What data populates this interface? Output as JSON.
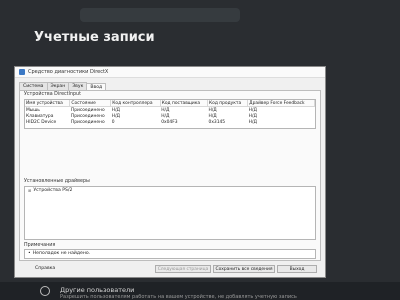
{
  "background": {
    "page_title": "Учетные записи",
    "section_title": "Другие пользователи",
    "section_desc": "Разрешить пользователям работать на вашем устройстве, не добавлять учетную запись"
  },
  "dialog": {
    "title": "Средство диагностики DirectX",
    "tabs": [
      "Система",
      "Экран",
      "Звук",
      "Ввод"
    ],
    "active_tab": "Ввод",
    "devices": {
      "label": "Устройства DirectInput",
      "columns": [
        "Имя устройства",
        "Состояние",
        "Код контроллера",
        "Код поставщика",
        "Код продукта",
        "Драйвер Force Feedback"
      ],
      "rows": [
        [
          "Мышь",
          "Присоединено",
          "Н/Д",
          "Н/Д",
          "Н/Д",
          "Н/Д"
        ],
        [
          "Клавиатура",
          "Присоединено",
          "Н/Д",
          "Н/Д",
          "Н/Д",
          "Н/Д"
        ],
        [
          "HID2C Device",
          "Присоединено",
          "0",
          "0x04F3",
          "0x3145",
          "Н/Д"
        ]
      ]
    },
    "drivers": {
      "label": "Установленные драйверы",
      "items": [
        "Устройства PS/2"
      ]
    },
    "notes": {
      "label": "Примечания",
      "items": [
        "Неполадок не найдено."
      ]
    },
    "buttons": {
      "help": "Справка",
      "next_page": "Следующая страница",
      "save_all": "Сохранить все сведения",
      "exit": "Выход"
    }
  }
}
